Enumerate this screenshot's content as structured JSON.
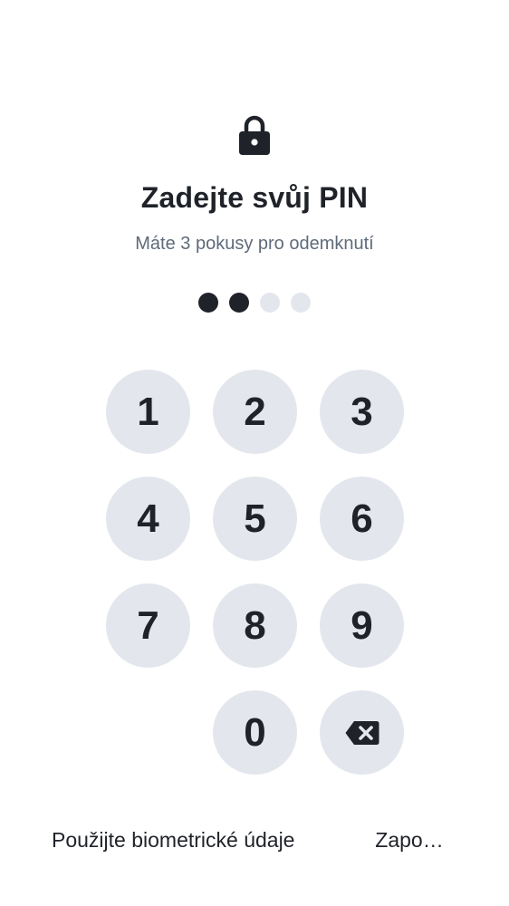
{
  "header": {
    "icon": "lock-icon",
    "title": "Zadejte svůj PIN",
    "subtitle": "Máte 3 pokusy pro odemknutí"
  },
  "pin": {
    "length": 4,
    "entered": 2
  },
  "keypad": {
    "keys": [
      "1",
      "2",
      "3",
      "4",
      "5",
      "6",
      "7",
      "8",
      "9",
      "0"
    ],
    "backspace_icon": "backspace-icon"
  },
  "footer": {
    "biometric_label": "Použijte biometrické údaje",
    "forgot_label": "Zapo…"
  },
  "colors": {
    "text": "#1f2329",
    "secondary_text": "#5f6b7a",
    "key_background": "#e3e7ed",
    "dot_empty": "#e3e7ed",
    "dot_filled": "#1f2329"
  }
}
